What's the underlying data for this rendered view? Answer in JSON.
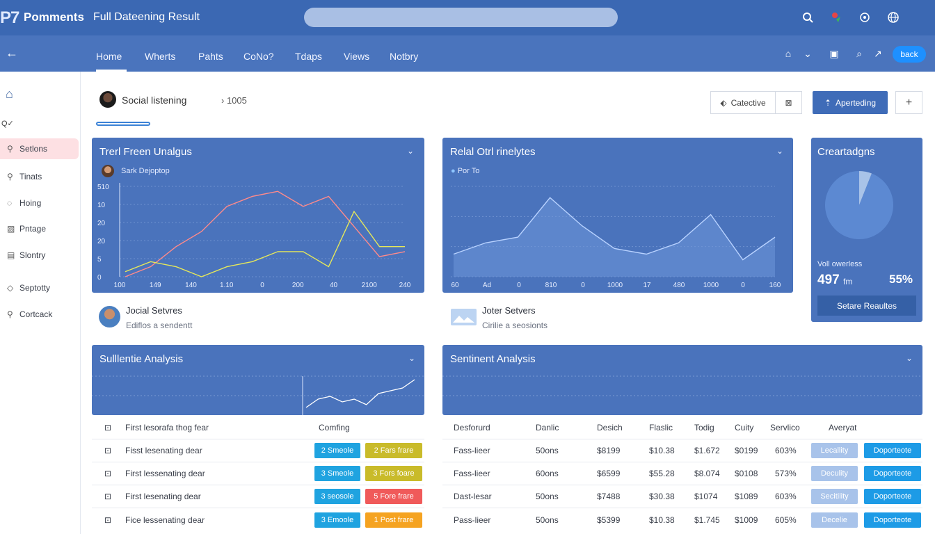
{
  "topbar": {
    "logo": "P7",
    "brand": "Pomments",
    "heading": "Full Dateening Result",
    "search_placeholder": ""
  },
  "nav": {
    "tabs": [
      "Home",
      "Wherts",
      "Pahts",
      "CoNo?",
      "Tdaps",
      "Views",
      "Notbry"
    ],
    "back_label": "back"
  },
  "sidebar": {
    "items": [
      "Setlons",
      "Tinats",
      "Hoing",
      "Pntage",
      "Slontry",
      "Septotty",
      "Cortcack"
    ],
    "extra": "Q✓"
  },
  "breadcrumb": {
    "title": "Social listening",
    "id": "1005",
    "catective": "Catective",
    "primary": "Aperteding",
    "plus": "+"
  },
  "card1": {
    "title": "Trerl Freen Unalgus",
    "legend": "Sark Dejoptop",
    "chart_data": {
      "type": "line",
      "x": [
        "100",
        "149",
        "140",
        "1.10",
        "0",
        "200",
        "40",
        "2100",
        "240"
      ],
      "y_ticks": [
        "0",
        "5",
        "20",
        "20",
        "10",
        "510"
      ],
      "series": [
        {
          "values": [
            0,
            2,
            6,
            9,
            14,
            16,
            17,
            14,
            16,
            10,
            4,
            5
          ]
        },
        {
          "values": [
            1,
            3,
            2,
            0,
            2,
            3,
            5,
            5,
            2,
            13,
            6,
            6
          ]
        }
      ]
    }
  },
  "card2": {
    "title": "Relal Otrl rinelytes",
    "legend": "Por To",
    "chart_data": {
      "type": "area",
      "x": [
        "60",
        "Ad",
        "0",
        "810",
        "0",
        "1000",
        "17",
        "480",
        "1000",
        "0",
        "160"
      ],
      "values": [
        4,
        6,
        7,
        14,
        9,
        5,
        4,
        6,
        11,
        3,
        7
      ]
    }
  },
  "card3": {
    "title": "Creartadgns",
    "note": "Voll owerless",
    "value": "497",
    "unit": "fm",
    "percent": "55%",
    "button": "Setare Reaultes",
    "chart_data": {
      "type": "pie",
      "values": [
        6,
        94
      ]
    }
  },
  "summaries": [
    {
      "title": "Jocial Setvres",
      "subtitle": "Ediflos a sendentt"
    },
    {
      "title": "Joter Setvers",
      "subtitle": "Cirilie a seosionts"
    }
  ],
  "card4": {
    "title": "Sulllentie Analysis",
    "chart_data": {
      "type": "line",
      "values": [
        2,
        5,
        6,
        4,
        5,
        3,
        7,
        8,
        9,
        12
      ]
    }
  },
  "card5": {
    "title": "Sentinent Analysis"
  },
  "table_left": {
    "header": [
      "First lesorafa thog fear",
      "Comfing"
    ],
    "rows": [
      {
        "name": "Fisst lesenating dear",
        "tag1": "2 Smeole",
        "tag2": "2 Fars frare"
      },
      {
        "name": "First lessenating dear",
        "tag1": "3 Smeole",
        "tag2": "3 Fors foare"
      },
      {
        "name": "First lesenating dear",
        "tag1": "3 seosole",
        "tag2": "5 Fore frare"
      },
      {
        "name": "Fice lessenating dear",
        "tag1": "3 Emoole",
        "tag2": "1 Post frare"
      }
    ]
  },
  "table_right": {
    "header": [
      "Desforurd",
      "Danlic",
      "Desich",
      "Flaslic",
      "Todig",
      "Cuity",
      "Servlico",
      "Averyat"
    ],
    "rows": [
      {
        "c": [
          "Fass-lieer",
          "50ons",
          "$8199",
          "$10.38",
          "$1.672",
          "$0199",
          "603%"
        ],
        "b1": "Lecallity",
        "b2": "Doporteote"
      },
      {
        "c": [
          "Fass-lieer",
          "60ons",
          "$6599",
          "$55.28",
          "$8.074",
          "$0108",
          "573%"
        ],
        "b1": "Deculity",
        "b2": "Doporteote"
      },
      {
        "c": [
          "Dast-lesar",
          "50ons",
          "$7488",
          "$30.38",
          "$1074",
          "$1089",
          "603%"
        ],
        "b1": "Secitility",
        "b2": "Doporteote"
      },
      {
        "c": [
          "Pass-lieer",
          "50ons",
          "$5399",
          "$10.38",
          "$1.745",
          "$1009",
          "605%"
        ],
        "b1": "Decelie",
        "b2": "Doporteote"
      }
    ]
  },
  "colors": {
    "topbar": "#3b68b3",
    "navbar": "#4a74bd",
    "card": "#4a73bc",
    "line_red": "#ff8a8a",
    "line_yellow": "#e6e85a",
    "tag_blue": "#1fa3e0",
    "tag_yellow": "#c9bb2a",
    "tag_red": "#f05a5a",
    "tag_orange": "#f5a321",
    "btn_light": "#a8c3ea",
    "btn_blue": "#1d9be6"
  }
}
